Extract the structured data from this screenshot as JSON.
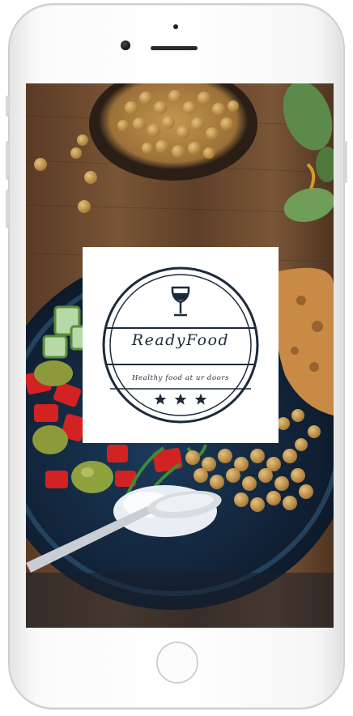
{
  "app": {
    "brand_name": "ReadyFood",
    "tagline": "Healthy food at ur doors"
  },
  "icons": {
    "logo_top": "wine-glass-icon",
    "logo_bottom": [
      "star-icon",
      "star-icon",
      "star-icon"
    ]
  },
  "colors": {
    "logo_ink": "#1c2a3a",
    "card_background": "#ffffff",
    "phone_body": "#ffffff"
  }
}
